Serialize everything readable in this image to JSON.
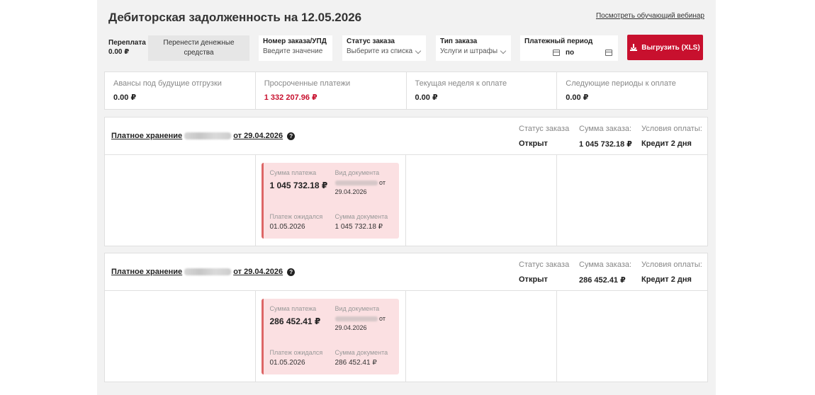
{
  "header": {
    "title": "Дебиторская задолженность на 12.05.2026",
    "webinar_link": "Посмотреть обучающий вебинар"
  },
  "filters": {
    "overpay_label": "Переплата",
    "overpay_value": "0.00 ₽",
    "transfer_button": "Перенести денежные средства",
    "order_number": {
      "label": "Номер заказа/УПД",
      "placeholder": "Введите значение"
    },
    "order_status": {
      "label": "Статус заказа",
      "value": "Выберите из списка"
    },
    "order_type": {
      "label": "Тип заказа",
      "value": "Услуги и штрафы"
    },
    "pay_period": {
      "label": "Платежный период",
      "to": "по"
    },
    "export_button": "Выгрузить (XLS)"
  },
  "summary": [
    {
      "label": "Авансы под будущие отгрузки",
      "value": "0.00 ₽"
    },
    {
      "label": "Просроченные платежи",
      "value": "1 332 207.96 ₽"
    },
    {
      "label": "Текущая неделя к оплате",
      "value": "0.00 ₽"
    },
    {
      "label": "Следующие периоды к оплате",
      "value": "0.00 ₽"
    }
  ],
  "orders": [
    {
      "title_prefix": "Платное хранение",
      "title_suffix": "от 29.04.2026",
      "status_label": "Статус заказа",
      "status_value": "Открыт",
      "sum_label": "Сумма заказа:",
      "sum_value": "1 045 732.18 ₽",
      "terms_label": "Условия оплаты:",
      "terms_value": "Кредит 2 дня",
      "payment": {
        "amount_label": "Сумма платежа",
        "amount_value": "1 045 732.18 ₽",
        "doc_label": "Вид документа",
        "doc_from": "от",
        "doc_date": "29.04.2026",
        "expected_label": "Платеж ожидался",
        "expected_value": "01.05.2026",
        "doc_sum_label": "Сумма документа",
        "doc_sum_value": "1 045 732.18 ₽"
      }
    },
    {
      "title_prefix": "Платное хранение",
      "title_suffix": "от 29.04.2026",
      "status_label": "Статус заказа",
      "status_value": "Открыт",
      "sum_label": "Сумма заказа:",
      "sum_value": "286 452.41 ₽",
      "terms_label": "Условия оплаты:",
      "terms_value": "Кредит 2 дня",
      "payment": {
        "amount_label": "Сумма платежа",
        "amount_value": "286 452.41 ₽",
        "doc_label": "Вид документа",
        "doc_from": "от",
        "doc_date": "29.04.2026",
        "expected_label": "Платеж ожидался",
        "expected_value": "01.05.2026",
        "doc_sum_label": "Сумма документа",
        "doc_sum_value": "286 452.41 ₽"
      }
    }
  ],
  "colors": {
    "accent": "#c8102e",
    "overdue_card": "#fbe0e2",
    "panel_bg": "#f2f2f2"
  },
  "icons": [
    "download-icon",
    "calendar-icon",
    "chevron-down-icon",
    "help-icon"
  ]
}
